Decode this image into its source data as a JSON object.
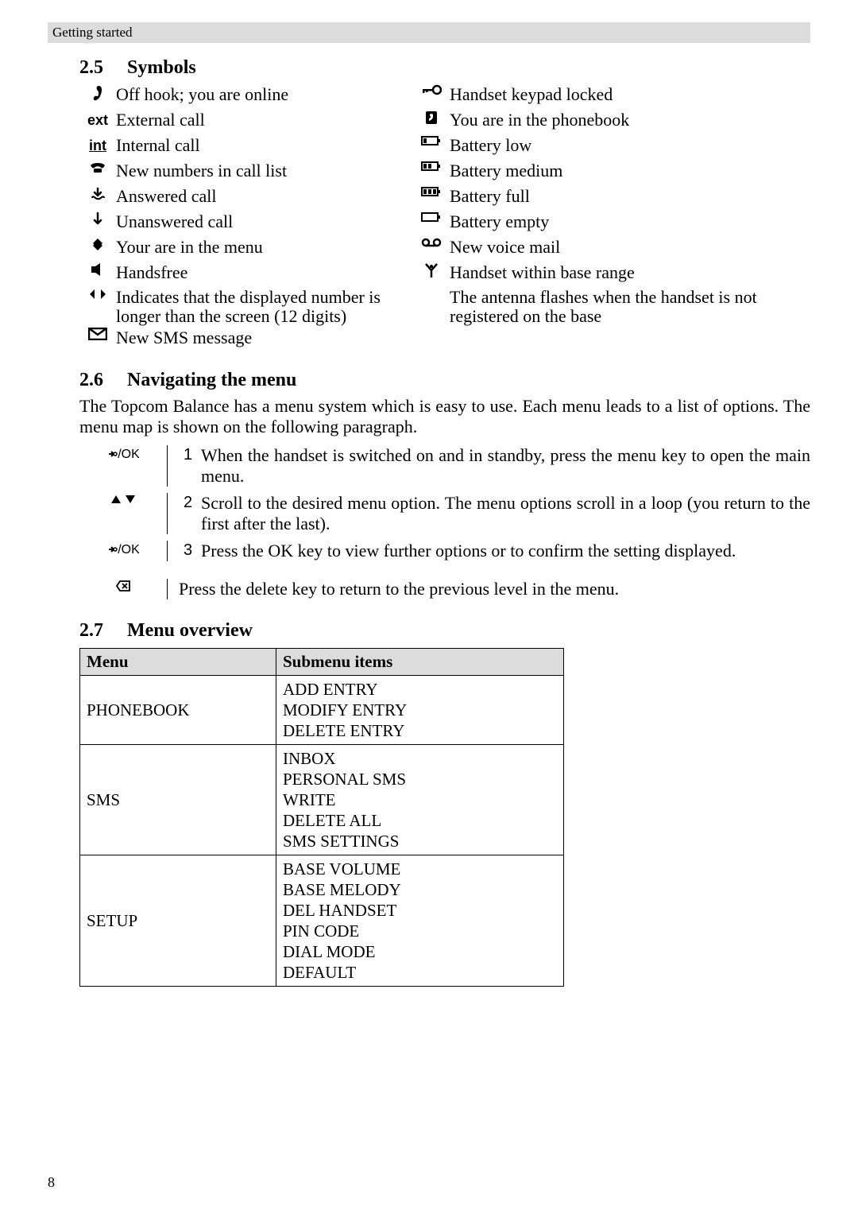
{
  "header": "Getting started",
  "page_number": "8",
  "section25": {
    "num": "2.5",
    "title": "Symbols",
    "left": [
      {
        "icon": "off-hook-icon",
        "text": "Off hook; you are online"
      },
      {
        "icon": "ext-icon",
        "icon_text": "ext",
        "text": "External call"
      },
      {
        "icon": "int-icon",
        "icon_text": "int",
        "text": "Internal call"
      },
      {
        "icon": "phone-icon",
        "text": "New numbers in call list"
      },
      {
        "icon": "answered-icon",
        "text": "Answered call"
      },
      {
        "icon": "unanswered-icon",
        "text": "Unanswered call"
      },
      {
        "icon": "menu-diamond-icon",
        "text": "Your are in the menu"
      },
      {
        "icon": "handsfree-icon",
        "text": "Handsfree"
      },
      {
        "icon": "arrows-lr-icon",
        "text": "Indicates that the displayed number is longer than the screen (12 digits)"
      },
      {
        "icon": "envelope-icon",
        "text": "New SMS message"
      }
    ],
    "right": [
      {
        "icon": "key-lock-icon",
        "text": "Handset keypad locked"
      },
      {
        "icon": "phonebook-icon",
        "text": "You are in the phonebook"
      },
      {
        "icon": "battery-low-icon",
        "text": "Battery low"
      },
      {
        "icon": "battery-med-icon",
        "text": "Battery medium"
      },
      {
        "icon": "battery-full-icon",
        "text": "Battery full"
      },
      {
        "icon": "battery-empty-icon",
        "text": "Battery empty"
      },
      {
        "icon": "voicemail-icon",
        "text": "New voice mail"
      },
      {
        "icon": "antenna-icon",
        "text": "Handset within base range"
      },
      {
        "icon": "",
        "text": "The antenna flashes when the handset is not registered on the base"
      }
    ]
  },
  "section26": {
    "num": "2.6",
    "title": "Navigating the menu",
    "intro": "The Topcom Balance has a menu system which is easy to use. Each menu leads to a list of options. The menu map is shown on the following paragraph.",
    "steps": [
      {
        "key": "menu-ok-icon",
        "key_text": "/OK",
        "n": "1",
        "text": "When the handset is switched on and in standby, press the menu key to open the main menu."
      },
      {
        "key": "up-down-icon",
        "key_text": "",
        "n": "2",
        "text": "Scroll to the desired menu option. The menu options scroll in a loop (you return to the first after the last)."
      },
      {
        "key": "menu-ok-icon",
        "key_text": "/OK",
        "n": "3",
        "text": "Press the OK key to view further options or to confirm the setting displayed."
      }
    ],
    "back": {
      "key": "delete-icon",
      "text": "Press the delete key to return to the previous level in the menu."
    }
  },
  "section27": {
    "num": "2.7",
    "title": "Menu overview",
    "headers": {
      "c1": "Menu",
      "c2": "Submenu items"
    },
    "rows": [
      {
        "menu": "PHONEBOOK",
        "sub": "ADD ENTRY\nMODIFY ENTRY\nDELETE ENTRY"
      },
      {
        "menu": "SMS",
        "sub": "INBOX\nPERSONAL SMS\nWRITE\nDELETE ALL\nSMS SETTINGS"
      },
      {
        "menu": "SETUP",
        "sub": "BASE VOLUME\nBASE MELODY\nDEL HANDSET\nPIN CODE\nDIAL MODE\nDEFAULT"
      }
    ]
  }
}
